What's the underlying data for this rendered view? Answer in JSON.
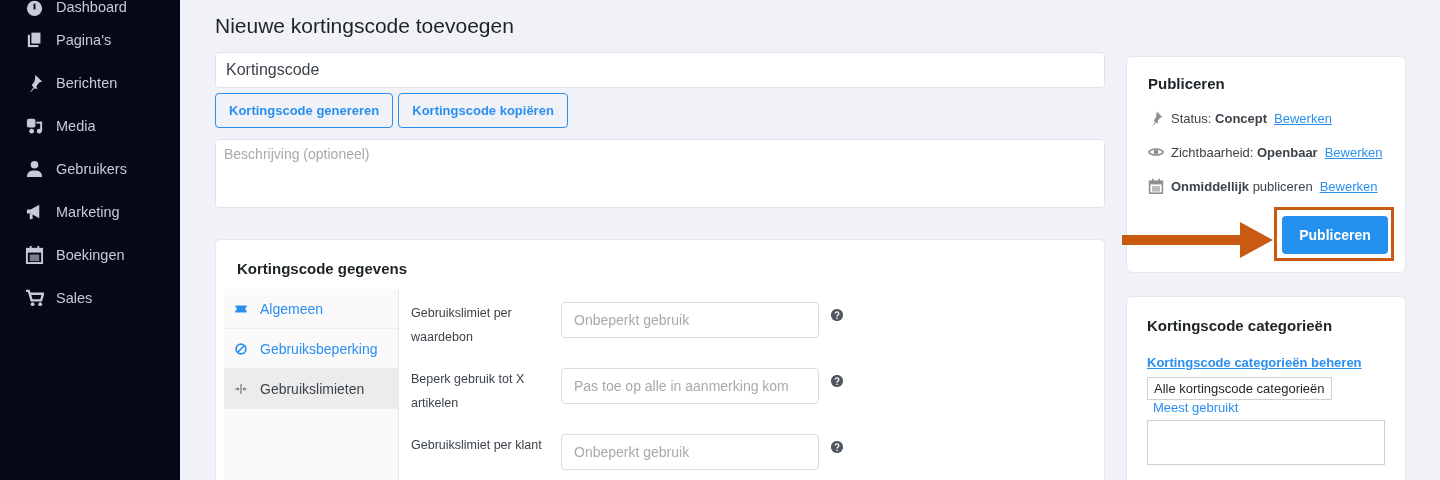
{
  "sidebar": {
    "items": [
      {
        "label": "Dashboard"
      },
      {
        "label": "Pagina's"
      },
      {
        "label": "Berichten"
      },
      {
        "label": "Media"
      },
      {
        "label": "Gebruikers"
      },
      {
        "label": "Marketing"
      },
      {
        "label": "Boekingen"
      },
      {
        "label": "Sales"
      }
    ]
  },
  "page_title": "Nieuwe kortingscode toevoegen",
  "code_field": {
    "value": "Kortingscode"
  },
  "code_buttons": [
    "Kortingscode genereren",
    "Kortingscode kopiëren"
  ],
  "description_field": {
    "placeholder": "Beschrijving (optioneel)"
  },
  "details_card": {
    "title": "Kortingscode gegevens",
    "tabs": [
      {
        "label": "Algemeen",
        "selected": false
      },
      {
        "label": "Gebruiksbeperking",
        "selected": false
      },
      {
        "label": "Gebruikslimieten",
        "selected": true
      }
    ],
    "fields": [
      {
        "label": "Gebruikslimiet per waardebon",
        "placeholder": "Onbeperkt gebruik"
      },
      {
        "label": "Beperk gebruik tot X artikelen",
        "placeholder": "Pas toe op alle in aanmerking kom"
      },
      {
        "label": "Gebruikslimiet per klant",
        "placeholder": "Onbeperkt gebruik"
      }
    ]
  },
  "publish_card": {
    "title": "Publiceren",
    "rows": [
      {
        "text": "Status: **Concept**",
        "link": "Bewerken"
      },
      {
        "text": "Zichtbaarheid: **Openbaar**",
        "link": "Bewerken"
      },
      {
        "text": "**Onmiddellijk** publiceren",
        "link": "Bewerken"
      }
    ],
    "button": "Publiceren"
  },
  "categories_card": {
    "title": "Kortingscode categorieën",
    "manage_link": "Kortingscode categorieën beheren",
    "tabs": [
      {
        "label": "Alle kortingscode categorieën",
        "selected": true
      },
      {
        "label": "Meest gebruikt",
        "selected": false
      }
    ]
  }
}
